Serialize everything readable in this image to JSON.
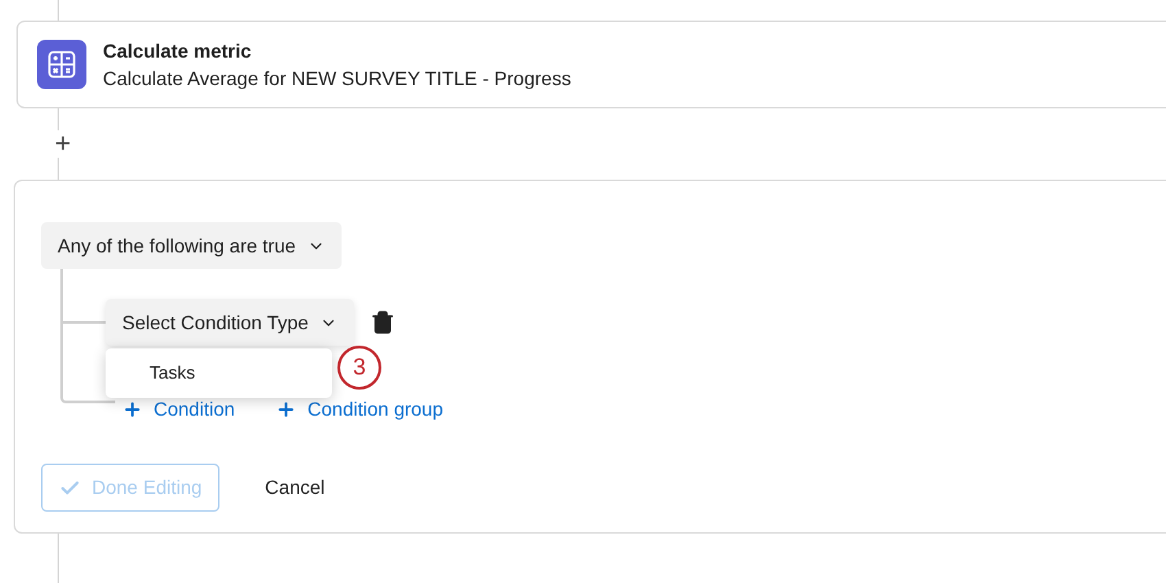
{
  "step": {
    "title": "Calculate metric",
    "subtitle": "Calculate Average for NEW SURVEY TITLE - Progress"
  },
  "add_step": "+",
  "conditions": {
    "group_select": "Any of the following are true",
    "condition_select": "Select Condition Type",
    "menu": [
      {
        "label": "Tasks"
      }
    ],
    "callout": "3",
    "links": [
      {
        "label": "Condition"
      },
      {
        "label": "Condition group"
      }
    ]
  },
  "buttons": [
    {
      "label": "Done Editing",
      "disabled": true
    },
    {
      "label": "Cancel",
      "disabled": false
    }
  ]
}
